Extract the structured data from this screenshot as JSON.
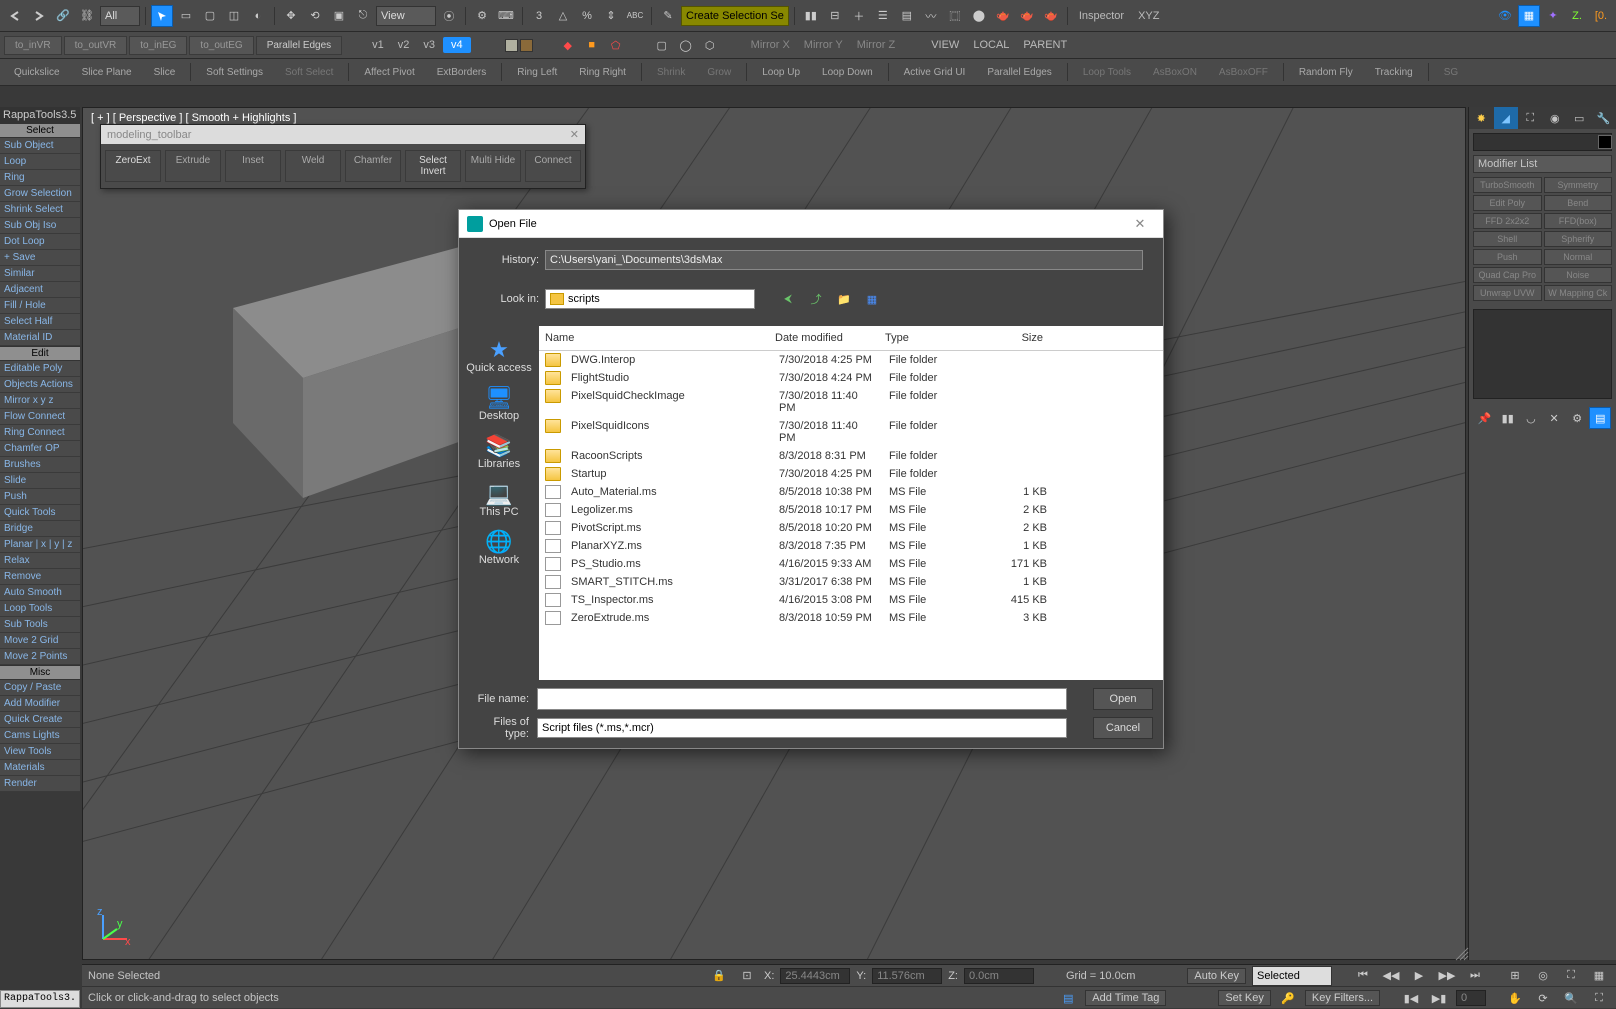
{
  "toolbar": {
    "filter_dd": "All",
    "view_dd": "View",
    "create_sel_dd": "Create Selection Se",
    "inspector": "Inspector",
    "xyz": "XYZ"
  },
  "row2": {
    "buttons": [
      "to_inVR",
      "to_outVR",
      "to_inEG",
      "to_outEG",
      "Parallel Edges"
    ],
    "verts": [
      "v1",
      "v2",
      "v3",
      "v4"
    ],
    "mirrors": [
      "Mirror X",
      "Mirror Y",
      "Mirror Z"
    ],
    "views": [
      "VIEW",
      "LOCAL",
      "PARENT"
    ]
  },
  "row3": [
    "Quickslice",
    "Slice Plane",
    "Slice",
    "Soft Settings",
    "Soft Select",
    "Affect Pivot",
    "ExtBorders",
    "Ring Left",
    "Ring Right",
    "Shrink",
    "Grow",
    "Loop Up",
    "Loop Down",
    "Active Grid UI",
    "Parallel Edges",
    "Loop Tools",
    "AsBoxON",
    "AsBoxOFF",
    "Random Fly",
    "Tracking",
    "SG"
  ],
  "rappa": {
    "title": "RappaTools3.5",
    "sections": [
      {
        "header": "Select",
        "items": [
          "Sub Object",
          "Loop",
          "Ring",
          "Grow Selection",
          "Shrink Select",
          "Sub Obj Iso",
          "Dot Loop",
          "+ Save",
          "Similar",
          "Adjacent",
          "Fill / Hole",
          "Select Half",
          "Material ID"
        ]
      },
      {
        "header": "Edit",
        "items": [
          "Editable Poly",
          "Objects Actions",
          "Mirror  x  y  z",
          "Flow Connect",
          "Ring Connect",
          "Chamfer OP",
          "Brushes",
          "Slide",
          "Push",
          "Quick Tools",
          "Bridge",
          "Planar | x | y | z",
          "Relax",
          "Remove",
          "Auto Smooth",
          "Loop Tools",
          "Sub Tools",
          "Move 2 Grid",
          "Move 2 Points"
        ]
      },
      {
        "header": "Misc",
        "items": [
          "Copy / Paste",
          "Add Modifier",
          "Quick Create",
          "Cams Lights",
          "View Tools",
          "Materials",
          "Render"
        ]
      }
    ]
  },
  "viewport": {
    "label": "[ + ] [ Perspective ] [ Smooth + Highlights ]"
  },
  "float_tb": {
    "title": "modeling_toolbar",
    "buttons": [
      "ZeroExt",
      "Extrude",
      "Inset",
      "Weld",
      "Chamfer",
      "Select Invert",
      "Multi Hide",
      "Connect"
    ]
  },
  "cmd_panel": {
    "mod_list_label": "Modifier List",
    "mods": [
      "TurboSmooth",
      "Symmetry",
      "Edit Poly",
      "Bend",
      "FFD 2x2x2",
      "FFD(box)",
      "Shell",
      "Spherify",
      "Push",
      "Normal",
      "Quad Cap Pro",
      "Noise",
      "Unwrap UVW",
      "W Mapping Ck"
    ]
  },
  "dialog": {
    "title": "Open File",
    "history_label": "History:",
    "history_path": "C:\\Users\\yani_\\Documents\\3dsMax",
    "lookin_label": "Look in:",
    "lookin_value": "scripts",
    "places": [
      "Quick access",
      "Desktop",
      "Libraries",
      "This PC",
      "Network"
    ],
    "columns": [
      "Name",
      "Date modified",
      "Type",
      "Size"
    ],
    "rows": [
      {
        "ico": "folder",
        "name": "DWG.Interop",
        "date": "7/30/2018 4:25 PM",
        "type": "File folder",
        "size": ""
      },
      {
        "ico": "folder",
        "name": "FlightStudio",
        "date": "7/30/2018 4:24 PM",
        "type": "File folder",
        "size": ""
      },
      {
        "ico": "folder",
        "name": "PixelSquidCheckImage",
        "date": "7/30/2018 11:40 PM",
        "type": "File folder",
        "size": ""
      },
      {
        "ico": "folder",
        "name": "PixelSquidIcons",
        "date": "7/30/2018 11:40 PM",
        "type": "File folder",
        "size": ""
      },
      {
        "ico": "folder",
        "name": "RacoonScripts",
        "date": "8/3/2018 8:31 PM",
        "type": "File folder",
        "size": ""
      },
      {
        "ico": "folder",
        "name": "Startup",
        "date": "7/30/2018 4:25 PM",
        "type": "File folder",
        "size": ""
      },
      {
        "ico": "file",
        "name": "Auto_Material.ms",
        "date": "8/5/2018 10:38 PM",
        "type": "MS File",
        "size": "1 KB"
      },
      {
        "ico": "file",
        "name": "Legolizer.ms",
        "date": "8/5/2018 10:17 PM",
        "type": "MS File",
        "size": "2 KB"
      },
      {
        "ico": "file",
        "name": "PivotScript.ms",
        "date": "8/5/2018 10:20 PM",
        "type": "MS File",
        "size": "2 KB"
      },
      {
        "ico": "file",
        "name": "PlanarXYZ.ms",
        "date": "8/3/2018 7:35 PM",
        "type": "MS File",
        "size": "1 KB"
      },
      {
        "ico": "file",
        "name": "PS_Studio.ms",
        "date": "4/16/2015 9:33 AM",
        "type": "MS File",
        "size": "171 KB"
      },
      {
        "ico": "file",
        "name": "SMART_STITCH.ms",
        "date": "3/31/2017 6:38 PM",
        "type": "MS File",
        "size": "1 KB"
      },
      {
        "ico": "file",
        "name": "TS_Inspector.ms",
        "date": "4/16/2015 3:08 PM",
        "type": "MS File",
        "size": "415 KB"
      },
      {
        "ico": "file",
        "name": "ZeroExtrude.ms",
        "date": "8/3/2018 10:59 PM",
        "type": "MS File",
        "size": "3 KB"
      }
    ],
    "filename_label": "File name:",
    "filename_value": "",
    "filetype_label": "Files of type:",
    "filetype_value": "Script files (*.ms,*.mcr)",
    "btn_open": "Open",
    "btn_cancel": "Cancel"
  },
  "status": {
    "sel": "None Selected",
    "prompt": "Click or click-and-drag to select objects",
    "x": "25.4443cm",
    "y": "11.576cm",
    "z": "0.0cm",
    "grid": "Grid = 10.0cm",
    "autokey": "Auto Key",
    "selected": "Selected",
    "setkey": "Set Key",
    "keyfilters": "Key Filters...",
    "spinner": "0",
    "addtime": "Add Time Tag"
  },
  "bl_float": "RappaTools3."
}
